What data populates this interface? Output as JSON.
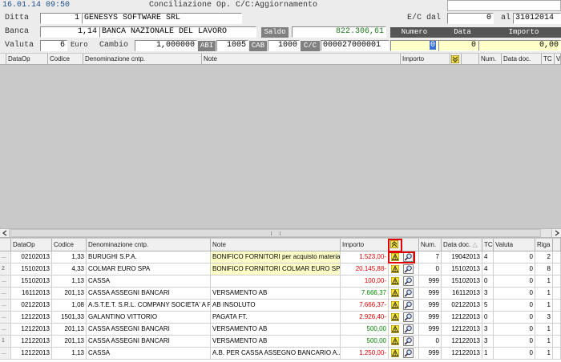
{
  "header": {
    "datetime": "16.01.14 09:50",
    "title": "Conciliazione Op. C/C:Aggiornamento"
  },
  "form": {
    "ditta_label": "Ditta",
    "ditta_code": "1",
    "ditta_name": "GENESYS SOFTWARE SRL",
    "banca_label": "Banca",
    "banca_code": "1,14",
    "banca_name": "BANCA NAZIONALE DEL LAVORO",
    "saldo_label": "Saldo",
    "saldo_value": "822.306,61",
    "valuta_label": "Valuta",
    "valuta_code": "6",
    "valuta_name": "Euro",
    "cambio_label": "Cambio",
    "cambio_value": "1,000000",
    "abi_label": "ABI",
    "abi_value": "1005",
    "cab_label": "CAB",
    "cab_value": "1000",
    "cc_label": "C/C",
    "cc_value": "000027000001",
    "ec_dal_label": "E/C dal",
    "ec_dal_value": "0",
    "al_label": "al",
    "al_value": "31012014",
    "numero_label": "Numero",
    "data_label": "Data",
    "importo_label": "Importo",
    "numero_value": "0",
    "data_value": "0",
    "importo_value": "0,00"
  },
  "upper_grid": {
    "columns": [
      "DataOp",
      "Codice",
      "Denominazione cntp.",
      "Note",
      "Importo",
      "Num.",
      "Data doc.",
      "TC",
      "V"
    ]
  },
  "lower_grid": {
    "columns": [
      "DataOp",
      "Codice",
      "Denominazione cntp.",
      "Note",
      "Importo",
      "Num.",
      "Data doc.",
      "TC",
      "Valuta",
      "Riga"
    ],
    "rows": [
      {
        "mark": "...",
        "dataop": "02102013",
        "codice": "1,33",
        "denom": "BURUGHI S.P.A.",
        "note": "BONIFICO FORNITORI per acquisto material...",
        "note_hl": true,
        "importo": "1.523,00-",
        "sign": "neg",
        "num": "7",
        "datadoc": "19042013",
        "tc": "4",
        "valuta": "0",
        "riga": "2"
      },
      {
        "mark": "2",
        "dataop": "15102013",
        "codice": "4,33",
        "denom": "COLMAR EURO SPA",
        "note": "BONIFICO FORNITORI COLMAR EURO SPA",
        "note_hl": true,
        "importo": "20.145,88-",
        "sign": "neg",
        "num": "0",
        "datadoc": "15102013",
        "tc": "4",
        "valuta": "0",
        "riga": "8"
      },
      {
        "mark": "...",
        "dataop": "15102013",
        "codice": "1,13",
        "denom": "CASSA",
        "note": "",
        "note_hl": false,
        "importo": "100,00-",
        "sign": "neg",
        "num": "999",
        "datadoc": "15102013",
        "tc": "0",
        "valuta": "0",
        "riga": "1"
      },
      {
        "mark": "...",
        "dataop": "16112013",
        "codice": "201,13",
        "denom": "CASSA ASSEGNI BANCARI",
        "note": "VERSAMENTO AB",
        "note_hl": false,
        "importo": "7.666,37",
        "sign": "pos",
        "num": "999",
        "datadoc": "16112013",
        "tc": "3",
        "valuta": "0",
        "riga": "1"
      },
      {
        "mark": "...",
        "dataop": "02122013",
        "codice": "1,08",
        "denom": "A.S.T.E.T. S.R.L. COMPANY SOCIETA' A R",
        "note": "AB INSOLUTO",
        "note_hl": false,
        "importo": "7.666,37-",
        "sign": "neg",
        "num": "999",
        "datadoc": "02122013",
        "tc": "5",
        "valuta": "0",
        "riga": "1"
      },
      {
        "mark": "...",
        "dataop": "12122013",
        "codice": "1501,33",
        "denom": "GALANTINO VITTORIO",
        "note": "PAGATA FT.",
        "note_hl": false,
        "importo": "2.926,40-",
        "sign": "neg",
        "num": "999",
        "datadoc": "12122013",
        "tc": "0",
        "valuta": "0",
        "riga": "3"
      },
      {
        "mark": "...",
        "dataop": "12122013",
        "codice": "201,13",
        "denom": "CASSA ASSEGNI BANCARI",
        "note": "VERSAMENTO AB",
        "note_hl": false,
        "importo": "500,00",
        "sign": "pos",
        "num": "999",
        "datadoc": "12122013",
        "tc": "3",
        "valuta": "0",
        "riga": "1"
      },
      {
        "mark": "1",
        "dataop": "12122013",
        "codice": "201,13",
        "denom": "CASSA ASSEGNI BANCARI",
        "note": "VERSAMENTO AB",
        "note_hl": false,
        "importo": "500,00",
        "sign": "pos",
        "num": "0",
        "datadoc": "12122013",
        "tc": "3",
        "valuta": "0",
        "riga": "1"
      },
      {
        "mark": "...",
        "dataop": "12122013",
        "codice": "1,13",
        "denom": "CASSA",
        "note": "A.B. PER CASSA ASSEGNO BANCARIO A...",
        "note_hl": false,
        "importo": "1.250,00-",
        "sign": "neg",
        "num": "999",
        "datadoc": "12122013",
        "tc": "1",
        "valuta": "0",
        "riga": "1"
      }
    ]
  },
  "colors": {
    "highlight_border": "#e00000",
    "negative": "#e00000",
    "positive": "#008800",
    "note_yellow": "#ffffc8"
  }
}
